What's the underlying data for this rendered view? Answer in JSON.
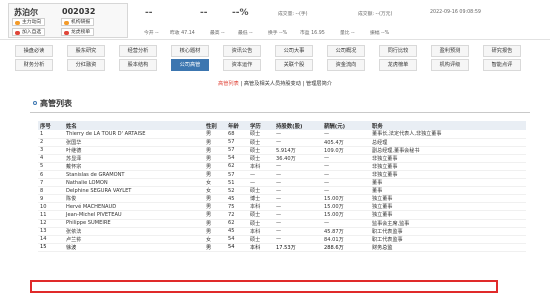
{
  "header": {
    "stock_name": "苏泊尔",
    "stock_code": "002032",
    "buttons": [
      {
        "label": "主力动向",
        "icon": "orange-dot-icon"
      },
      {
        "label": "机构研报",
        "icon": "orange-dot-icon"
      },
      {
        "label": "加入自选",
        "icon": "red-dot-icon"
      },
      {
        "label": "龙虎榜单",
        "icon": "red-dot-icon"
      }
    ],
    "price": "--",
    "change": "--",
    "pct": "--%",
    "volume_label": "成交量: --(手)",
    "amount_label": "成交额: --(万元)",
    "timestamp": "2022-09-16 09:08:59",
    "info_row": [
      "今开 --",
      "昨收 47.14",
      "最高 --",
      "最低 --",
      "换手 --%",
      "市盈 16.95",
      "量比 --",
      "振幅 --%"
    ]
  },
  "menu": {
    "row1": [
      "操盘必读",
      "股东研究",
      "经营分析",
      "核心题材",
      "资讯公告",
      "公司大事",
      "公司概况",
      "同行比较",
      "盈利预测",
      "研究报告"
    ],
    "row2": [
      "财务分析",
      "分红融资",
      "股本结构",
      "公司高管",
      "资本运作",
      "关联个股",
      "资金流向",
      "龙虎榜单",
      "机构评级",
      "智能点评"
    ],
    "active": "公司高管"
  },
  "subnav": {
    "items": [
      "高管列表",
      "高管及相关人员持股变动",
      "管理层简介"
    ],
    "current": "高管列表"
  },
  "section": {
    "title": "高管列表"
  },
  "table": {
    "headers": [
      "序号",
      "姓名",
      "性别",
      "年龄",
      "学历",
      "持股数(股)",
      "薪酬(元)",
      "职务"
    ],
    "rows": [
      [
        "1",
        "Thierry de LA TOUR D' ARTAISE",
        "男",
        "68",
        "硕士",
        "—",
        "—",
        "董事长,法定代表人,非独立董事"
      ],
      [
        "2",
        "张国华",
        "男",
        "57",
        "硕士",
        "—",
        "405.4万",
        "总经理"
      ],
      [
        "3",
        "叶继德",
        "男",
        "57",
        "硕士",
        "5.914万",
        "109.0万",
        "副总经理,董事会秘书"
      ],
      [
        "4",
        "苏显泽",
        "男",
        "54",
        "硕士",
        "36.40万",
        "—",
        "非独立董事"
      ],
      [
        "5",
        "戴怀宗",
        "男",
        "62",
        "本科",
        "—",
        "—",
        "非独立董事"
      ],
      [
        "6",
        "Stanislas de GRAMONT",
        "男",
        "57",
        "—",
        "—",
        "—",
        "非独立董事"
      ],
      [
        "7",
        "Nathalie LOMON",
        "女",
        "51",
        "—",
        "—",
        "—",
        "董事"
      ],
      [
        "8",
        "Delphine SEGURA VAYLET",
        "女",
        "52",
        "硕士",
        "—",
        "—",
        "董事"
      ],
      [
        "9",
        "陈俊",
        "男",
        "45",
        "博士",
        "—",
        "15.00万",
        "独立董事"
      ],
      [
        "10",
        "Hervé MACHENAUD",
        "男",
        "75",
        "本科",
        "—",
        "15.00万",
        "独立董事"
      ],
      [
        "11",
        "Jean-Michel PIVETEAU",
        "男",
        "72",
        "硕士",
        "—",
        "15.00万",
        "独立董事"
      ],
      [
        "12",
        "Philippe SUMEIRE",
        "男",
        "62",
        "硕士",
        "—",
        "—",
        "监事会主席,监事"
      ],
      [
        "13",
        "张依法",
        "男",
        "45",
        "本科",
        "—",
        "45.87万",
        "职工代表监事"
      ],
      [
        "14",
        "卢兰荪",
        "女",
        "54",
        "硕士",
        "—",
        "84.01万",
        "职工代表监事"
      ],
      [
        "15",
        "徐波",
        "男",
        "54",
        "本科",
        "17.53万",
        "288.6万",
        "财务总监"
      ]
    ]
  },
  "colors": {
    "accent": "#3c76b0",
    "highlight": "#e02a2a"
  }
}
